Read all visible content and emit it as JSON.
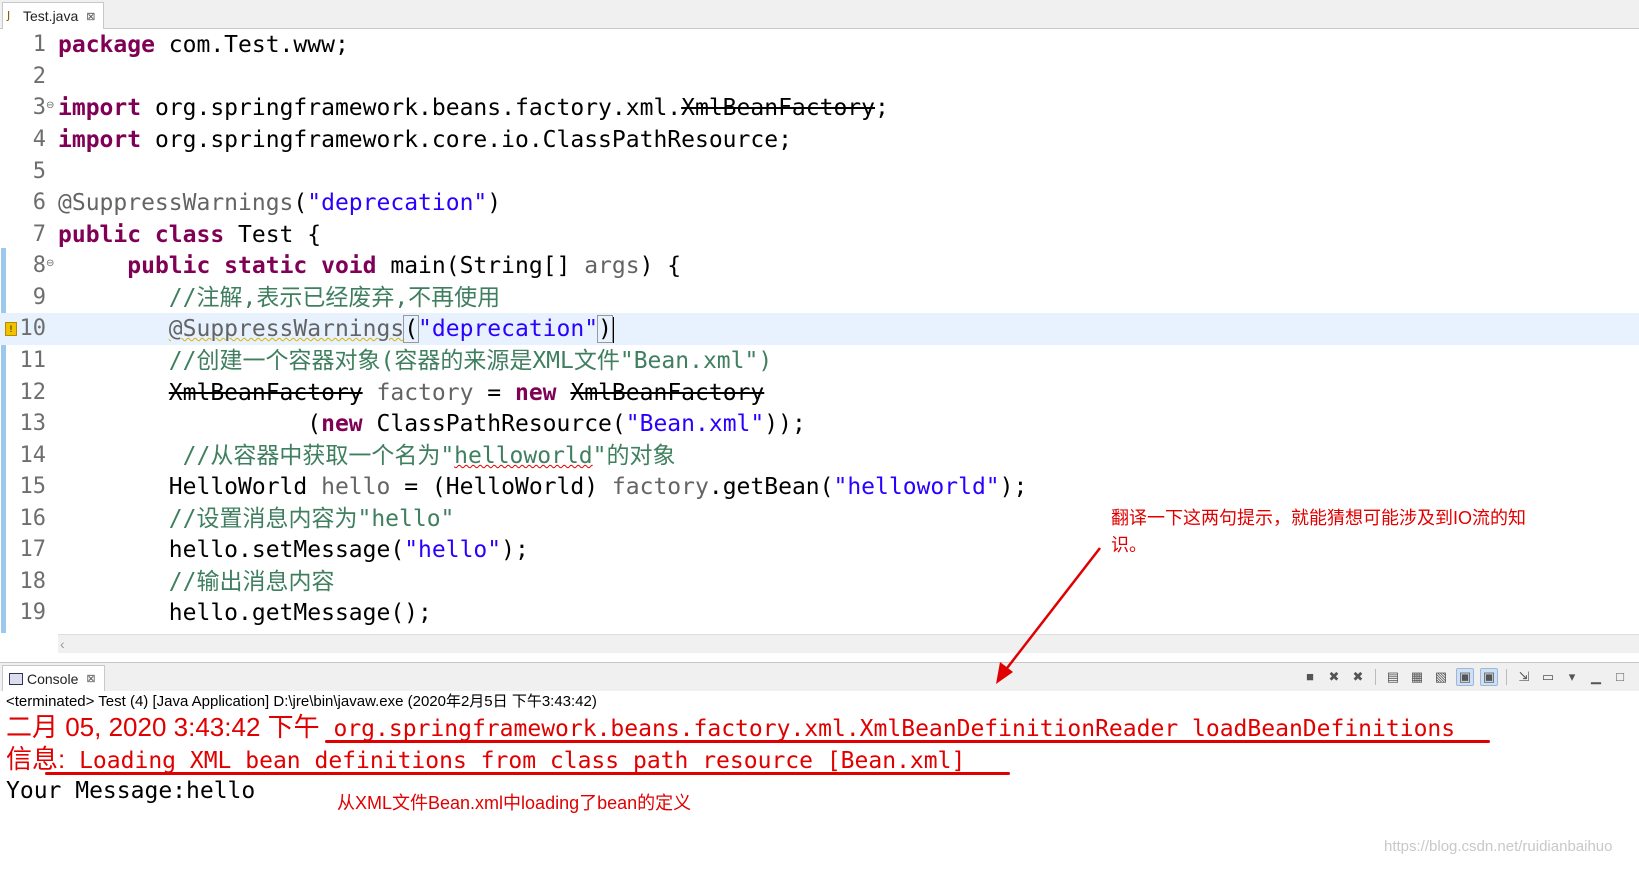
{
  "editor": {
    "tab_label": "Test.java",
    "tab_close": "⊠",
    "java_icon": "J",
    "lines": [
      {
        "no": "1"
      },
      {
        "no": "2"
      },
      {
        "no": "3"
      },
      {
        "no": "4"
      },
      {
        "no": "5"
      },
      {
        "no": "6"
      },
      {
        "no": "7"
      },
      {
        "no": "8"
      },
      {
        "no": "9"
      },
      {
        "no": "10"
      },
      {
        "no": "11"
      },
      {
        "no": "12"
      },
      {
        "no": "13"
      },
      {
        "no": "14"
      },
      {
        "no": "15"
      },
      {
        "no": "16"
      },
      {
        "no": "17"
      },
      {
        "no": "18"
      },
      {
        "no": "19"
      }
    ],
    "code": {
      "l1_kw": "package",
      "l1_rest": " com.Test.www;",
      "l3_kw": "import",
      "l3_pkg": " org.springframework.beans.factory.xml.",
      "l3_dep": "XmlBeanFactory",
      "l3_end": ";",
      "l4_kw": "import",
      "l4_rest": " org.springframework.core.io.ClassPathResource;",
      "l6_ann": "@SuppressWarnings",
      "l6_open": "(",
      "l6_str": "\"deprecation\"",
      "l6_close": ")",
      "l7_kw": "public class",
      "l7_rest": " Test {",
      "l8_indent": "     ",
      "l8_kw": "public static void",
      "l8_rest": " main(String[] ",
      "l8_args": "args",
      "l8_end": ") {",
      "l9_indent": "        ",
      "l9_cm": "//注解,表示已经废弃,不再使用",
      "l10_indent": "        ",
      "l10_ann": "@SuppressWarnings",
      "l10_open": "(",
      "l10_str": "\"deprecation\"",
      "l10_close": ")",
      "l11_indent": "        ",
      "l11_cm": "//创建一个容器对象(容器的来源是XML文件\"Bean.xml\")",
      "l12_indent": "        ",
      "l12_dep1": "XmlBeanFactory",
      "l12_var": " factory",
      "l12_eq": " = ",
      "l12_kw": "new",
      "l12_sp": " ",
      "l12_dep2": "XmlBeanFactory",
      "l13_indent": "                  (",
      "l13_kw": "new",
      "l13_rest": " ClassPathResource(",
      "l13_str": "\"Bean.xml\"",
      "l13_end": "));",
      "l14_indent": "         ",
      "l14_cm1": "//从容器中获取一个名为\"",
      "l14_cm2": "helloworld",
      "l14_cm3": "\"的对象",
      "l15_indent": "        ",
      "l15_a": "HelloWorld ",
      "l15_var": "hello",
      "l15_b": " = (HelloWorld) ",
      "l15_fac": "factory",
      "l15_c": ".getBean(",
      "l15_str": "\"helloworld\"",
      "l15_end": ");",
      "l16_indent": "        ",
      "l16_cm": "//设置消息内容为\"hello\"",
      "l17_indent": "        ",
      "l17_a": "hello.setMessage(",
      "l17_str": "\"hello\"",
      "l17_end": ");",
      "l18_indent": "        ",
      "l18_cm": "//输出消息内容",
      "l19_indent": "        ",
      "l19_a": "hello.getMessage();"
    }
  },
  "console": {
    "tab_label": "Console",
    "tab_close": "⊠",
    "terminated": "<terminated> Test (4) [Java Application] D:\\jre\\bin\\javaw.exe (2020年2月5日 下午3:43:42)",
    "line1_date": "二月 05, 2020 3:43:42 下午",
    "line1_rest": " org.springframework.beans.factory.xml.XmlBeanDefinitionReader loadBeanDefinitions",
    "line2_prefix": "信息:",
    "line2_rest": " Loading XML bean definitions from class path resource [Bean.xml]",
    "line3": "Your Message:hello",
    "toolbar_icons": [
      "terminate-icon",
      "remove-launch-icon",
      "remove-all-icon",
      "clear-console-icon",
      "scroll-lock-icon",
      "word-wrap-icon",
      "show-stdout-icon",
      "show-stderr-icon",
      "pin-console-icon",
      "display-console-icon",
      "view-menu-icon",
      "minimize-icon",
      "maximize-icon"
    ]
  },
  "annotations": {
    "note_top_1": "翻译一下这两句提示，就能猜想可能涉及到IO流的知",
    "note_top_2": "识。",
    "note_bottom": "从XML文件Bean.xml中loading了bean的定义",
    "accent_color": "#e00000"
  },
  "watermark": "https://blog.csdn.net/ruidianbaihuo"
}
